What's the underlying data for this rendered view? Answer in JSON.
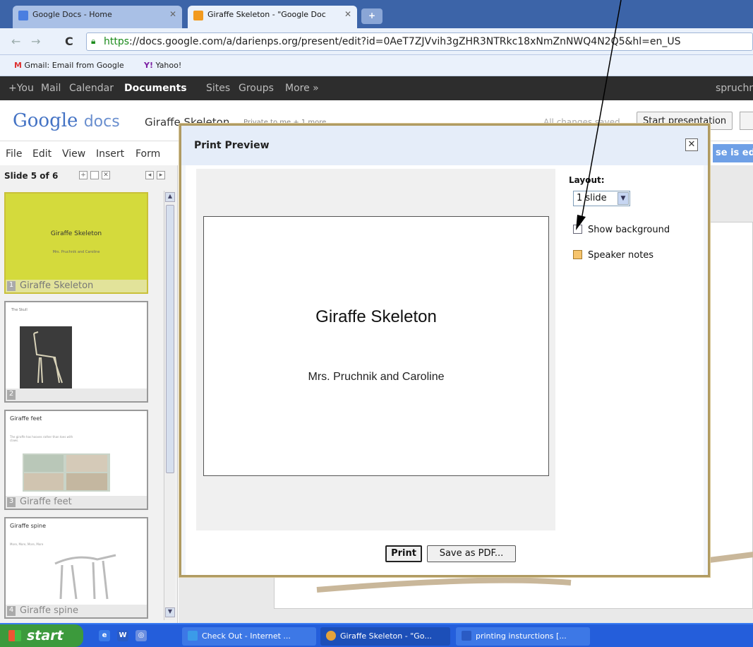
{
  "browser": {
    "tabs": [
      {
        "label": "Google Docs - Home"
      },
      {
        "label": "Giraffe Skeleton - \"Google Doc"
      }
    ],
    "new_tab_label": "+",
    "url_scheme": "https",
    "url_rest": "://docs.google.com/a/darienps.org/present/edit?id=0AeT7ZJVvih3gZHR3NTRkc18xNmZnNWQ4N2Q5&hl=en_US",
    "bookmarks": [
      {
        "label": "Gmail: Email from Google"
      },
      {
        "label": "Yahoo!"
      }
    ]
  },
  "gbar": {
    "items": [
      "+You",
      "Mail",
      "Calendar",
      "Documents",
      "Sites",
      "Groups",
      "More »"
    ],
    "user": "spruchn"
  },
  "docs": {
    "logo_google": "Google",
    "logo_docs": "docs",
    "title": "Giraffe Skeleton",
    "privacy": "Private to me + 1 more",
    "save_state": "All changes saved",
    "start_presentation": "Start presentation",
    "menu": [
      "File",
      "Edit",
      "View",
      "Insert",
      "Form"
    ],
    "collab_notice": "se is ed"
  },
  "sidebar": {
    "slide_count": "Slide 5 of 6",
    "slides": [
      {
        "num": "1",
        "label": "Giraffe Skeleton",
        "title": "Giraffe Skeleton",
        "subtitle": "Mrs. Pruchnik and Caroline"
      },
      {
        "num": "2",
        "label": "",
        "title": "The Skull",
        "subtitle": ""
      },
      {
        "num": "3",
        "label": "Giraffe feet",
        "title": "Giraffe feet",
        "subtitle": "The giraffe has hooves rather than toes with claws."
      },
      {
        "num": "4",
        "label": "Giraffe spine",
        "title": "Giraffe spine",
        "subtitle": "More, More, More, More"
      }
    ]
  },
  "dialog": {
    "title": "Print Preview",
    "close_label": "✕",
    "preview": {
      "title": "Giraffe Skeleton",
      "subtitle": "Mrs. Pruchnik and Caroline"
    },
    "layout_label": "Layout:",
    "layout_value": "1 slide",
    "show_background_label": "Show background",
    "speaker_notes_label": "Speaker notes",
    "print_label": "Print",
    "pdf_label": "Save as PDF..."
  },
  "taskbar": {
    "start_label": "start",
    "tasks": [
      {
        "label": "Check Out - Internet ..."
      },
      {
        "label": "Giraffe Skeleton - \"Go..."
      },
      {
        "label": "printing insturctions [..."
      }
    ]
  },
  "colors": {
    "accent": "#4372c4",
    "dialog_border": "#b09b62",
    "thumb_yellow": "#d4da3c"
  }
}
